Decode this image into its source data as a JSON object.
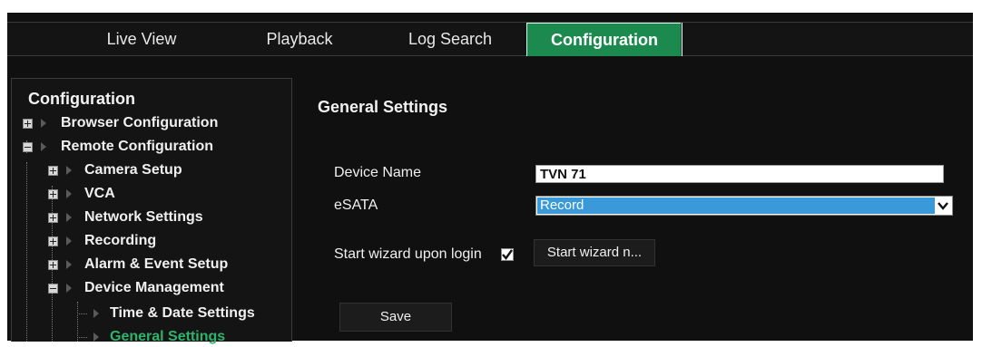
{
  "nav": {
    "tabs": [
      {
        "label": "Live View"
      },
      {
        "label": "Playback"
      },
      {
        "label": "Log Search"
      },
      {
        "label": "Configuration",
        "active": true
      }
    ]
  },
  "sidebar": {
    "title": "Configuration",
    "items": [
      {
        "label": "Browser Configuration",
        "expander": "plus"
      },
      {
        "label": "Remote Configuration",
        "expander": "minus"
      },
      {
        "label": "Camera Setup",
        "expander": "plus"
      },
      {
        "label": "VCA",
        "expander": "plus"
      },
      {
        "label": "Network Settings",
        "expander": "plus"
      },
      {
        "label": "Recording",
        "expander": "plus"
      },
      {
        "label": "Alarm & Event Setup",
        "expander": "plus"
      },
      {
        "label": "Device Management",
        "expander": "minus"
      },
      {
        "label": "Time & Date Settings"
      },
      {
        "label": "General Settings",
        "selected": true
      }
    ]
  },
  "main": {
    "title": "General Settings",
    "device_name": {
      "label": "Device Name",
      "value": "TVN 71"
    },
    "esata": {
      "label": "eSATA",
      "selected": "Record"
    },
    "wizard": {
      "label": "Start wizard upon login",
      "checked": true,
      "button_label": "Start wizard n..."
    },
    "save_label": "Save"
  },
  "colors": {
    "active_tab": "#1c8a4e",
    "selected_item": "#2db36b",
    "select_highlight": "#3a9ad9",
    "background": "#101010"
  }
}
